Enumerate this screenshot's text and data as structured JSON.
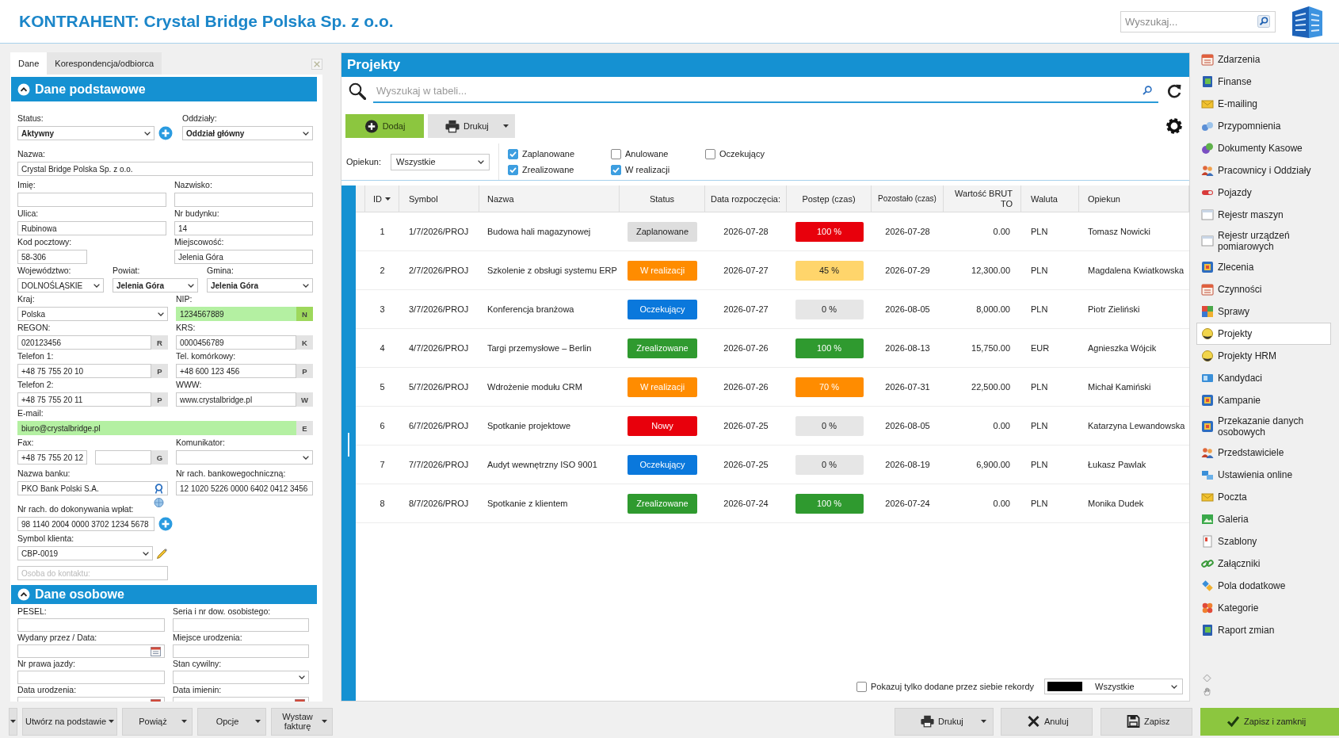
{
  "header": {
    "title": "KONTRAHENT: Crystal Bridge Polska Sp. z o.o.",
    "search": {
      "placeholder": "Wyszukaj..."
    }
  },
  "left_panel": {
    "tabs": [
      {
        "label": "Dane",
        "selected": true
      },
      {
        "label": "Korespondencja/odbiorca",
        "selected": false
      }
    ],
    "sections": [
      {
        "title": "Dane podstawowe",
        "expanded": true,
        "rows": [
          [
            {
              "label": "Status:",
              "value": "Aktywny",
              "kind": "select-add",
              "bold": true,
              "highlighted": false
            },
            {
              "label": "Oddziały:",
              "value": "Oddział główny",
              "kind": "select",
              "bold": true,
              "highlighted": false
            }
          ],
          [
            {
              "label": "Nazwa:",
              "value": "Crystal Bridge Polska Sp. z o.o.",
              "kind": "text",
              "bold": false,
              "highlighted": false
            }
          ],
          [
            {
              "label": "Imię:",
              "kind": "text",
              "bold": false,
              "highlighted": false
            },
            {
              "label": "Nazwisko:",
              "kind": "text",
              "bold": false,
              "highlighted": false
            }
          ],
          [
            {
              "label": "Ulica:",
              "value": "Rubinowa",
              "kind": "text",
              "bold": false,
              "highlighted": false
            },
            {
              "label": "Nr budynku:",
              "value": "14",
              "kind": "text",
              "bold": false,
              "highlighted": false
            }
          ],
          [
            {
              "label": "Kod pocztowy:",
              "value": "58-306",
              "kind": "text",
              "bold": false,
              "highlighted": false
            },
            {
              "label": "Miejscowość:",
              "value": "Jelenia Góra",
              "kind": "text",
              "bold": false,
              "highlighted": false
            }
          ],
          [
            {
              "label": "Województwo:",
              "value": "DOLNOŚLĄSKIE",
              "kind": "select",
              "bold": false,
              "highlighted": false
            },
            {
              "label": "Powiat:",
              "value": "Jelenia Góra",
              "kind": "select",
              "bold": true,
              "highlighted": false
            },
            {
              "label": "Gmina:",
              "value": "Jelenia Góra",
              "kind": "select",
              "bold": true,
              "highlighted": false
            }
          ],
          [
            {
              "label": "Kraj:",
              "value": "Polska",
              "kind": "select",
              "bold": false,
              "highlighted": false
            },
            {
              "label": "NIP:",
              "value": "1234567889",
              "kind": "suffix",
              "suffix": "N",
              "suffix_highlighted": true,
              "bold": false,
              "highlighted": true
            }
          ],
          [
            {
              "label": "REGON:",
              "value": "020123456",
              "kind": "suffix",
              "suffix": "R",
              "suffix_highlighted": false,
              "bold": false,
              "highlighted": false
            },
            {
              "label": "KRS:",
              "value": "0000456789",
              "kind": "suffix",
              "suffix": "K",
              "suffix_highlighted": false,
              "bold": false,
              "highlighted": false
            }
          ],
          [
            {
              "label": "Telefon 1:",
              "value": "+48 75 755 20 10",
              "kind": "suffix",
              "suffix": "P",
              "suffix_highlighted": false,
              "bold": false,
              "highlighted": false
            },
            {
              "label": "Tel. komórkowy:",
              "value": "+48 600 123 456",
              "kind": "suffix",
              "suffix": "P",
              "suffix_highlighted": false,
              "bold": false,
              "highlighted": false
            }
          ],
          [
            {
              "label": "Telefon 2:",
              "value": "+48 75 755 20 11",
              "kind": "suffix",
              "suffix": "P",
              "suffix_highlighted": false,
              "bold": false,
              "highlighted": false
            },
            {
              "label": "WWW:",
              "value": "www.crystalbridge.pl",
              "kind": "suffix",
              "suffix": "W",
              "suffix_highlighted": false,
              "bold": false,
              "highlighted": false
            }
          ],
          [
            {
              "label": "E-mail:",
              "value": "biuro@crystalbridge.pl",
              "kind": "suffix",
              "suffix": "E",
              "suffix_highlighted": false,
              "bold": false,
              "highlighted": true
            }
          ],
          [
            {
              "label": "Fax:",
              "value": "+48 75 755 20 12",
              "kind": "text",
              "bold": false,
              "highlighted": false
            },
            {
              "kind": "suffix",
              "suffix": "G",
              "suffix_highlighted": false,
              "bold": false,
              "highlighted": false
            },
            {
              "label": "Komunikator:",
              "kind": "select",
              "bold": false,
              "highlighted": false
            }
          ],
          [
            {
              "label": "Nazwa banku:",
              "value": "PKO Bank Polski S.A.",
              "kind": "bank",
              "bold": false,
              "highlighted": false
            },
            {
              "label": "Nr rach. bankowegochniczną:",
              "value": "12 1020 5226 0000 6402 0412 3456",
              "kind": "text",
              "bold": false,
              "highlighted": false
            }
          ],
          [
            {
              "label": "Nr rach. do dokonywania wpłat:",
              "value": "98 1140 2004 0000 3702 1234 5678",
              "kind": "text-add",
              "bold": false,
              "highlighted": false
            }
          ],
          [
            {
              "label": "Symbol klienta:",
              "value": "CBP-0019",
              "kind": "select-edit",
              "bold": false,
              "highlighted": false
            }
          ],
          [
            {
              "placeholder": "Osoba do kontaktu:",
              "kind": "text",
              "bold": false,
              "highlighted": false
            }
          ]
        ]
      },
      {
        "title": "Dane osobowe",
        "expanded": true,
        "rows": [
          [
            {
              "label": "PESEL:",
              "kind": "text",
              "bold": false,
              "highlighted": false
            },
            {
              "label": "Seria i nr dow. osobistego:",
              "kind": "text",
              "bold": false,
              "highlighted": false
            }
          ],
          [
            {
              "label": "Wydany przez / Data:",
              "kind": "date",
              "bold": false,
              "highlighted": false
            },
            {
              "label": "Miejsce urodzenia:",
              "kind": "text",
              "bold": false,
              "highlighted": false
            }
          ],
          [
            {
              "label": "Nr prawa jazdy:",
              "kind": "text",
              "bold": false,
              "highlighted": false
            },
            {
              "label": "Stan cywilny:",
              "kind": "select",
              "bold": false,
              "highlighted": false
            }
          ],
          [
            {
              "label": "Data urodzenia:",
              "kind": "date",
              "bold": false,
              "highlighted": false
            },
            {
              "label": "Data imienin:",
              "kind": "date",
              "bold": false,
              "highlighted": false
            }
          ]
        ]
      }
    ]
  },
  "projects_panel": {
    "title": "Projekty",
    "search": {
      "placeholder": "Wyszukaj w tabeli..."
    },
    "buttons": [
      {
        "label": "Dodaj",
        "kind": "add"
      },
      {
        "label": "Drukuj",
        "kind": "print"
      }
    ],
    "owner_filter": {
      "label": "Opiekun:",
      "value": "Wszystkie"
    },
    "status_filters": [
      {
        "label": "Zaplanowane",
        "checked": true
      },
      {
        "label": "Anulowane",
        "checked": false
      },
      {
        "label": "Oczekujący",
        "checked": false
      },
      {
        "label": "Zrealizowane",
        "checked": true
      },
      {
        "label": "W realizacji",
        "checked": true
      }
    ],
    "table": {
      "columns": [
        {
          "label": "ID",
          "sorted": true
        },
        {
          "label": "Symbol",
          "sorted": false
        },
        {
          "label": "Nazwa",
          "sorted": false
        },
        {
          "label": "Status",
          "sorted": false
        },
        {
          "label": "Data rozpoczęcia:",
          "sorted": false
        },
        {
          "label": "Postęp (czas)",
          "sorted": false
        },
        {
          "label": "Pozostało (czas)",
          "sorted": false
        },
        {
          "label": "Wartość BRUTTO",
          "sorted": false
        },
        {
          "label": "Waluta",
          "sorted": false
        },
        {
          "label": "Opiekun",
          "sorted": false
        }
      ],
      "rows": [
        {
          "id": "1",
          "symbol": "1/7/2026/PROJ",
          "name": "Budowa hali magazynowej",
          "status": {
            "label": "Zaplanowane",
            "color": "#dedede"
          },
          "start_date": "2026-07-28",
          "progress": {
            "label": "100 %",
            "color": "#e8000c"
          },
          "remaining": "2026-07-28",
          "value": "0.00",
          "currency": "PLN",
          "owner": "Tomasz Nowicki"
        },
        {
          "id": "2",
          "symbol": "2/7/2026/PROJ",
          "name": "Szkolenie z obsługi systemu ERP",
          "status": {
            "label": "W realizacji",
            "color": "#ff8c00"
          },
          "start_date": "2026-07-27",
          "progress": {
            "label": "45 %",
            "color": "#ffd56b"
          },
          "remaining": "2026-07-29",
          "value": "12,300.00",
          "currency": "PLN",
          "owner": "Magdalena Kwiatkowska"
        },
        {
          "id": "3",
          "symbol": "3/7/2026/PROJ",
          "name": "Konferencja branżowa",
          "status": {
            "label": "Oczekujący",
            "color": "#0a78dc"
          },
          "start_date": "2026-07-27",
          "progress": {
            "label": "0 %",
            "color": "#e6e6e6"
          },
          "remaining": "2026-08-05",
          "value": "8,000.00",
          "currency": "PLN",
          "owner": "Piotr Zieliński"
        },
        {
          "id": "4",
          "symbol": "4/7/2026/PROJ",
          "name": "Targi przemysłowe – Berlin",
          "status": {
            "label": "Zrealizowane",
            "color": "#2f9a2f"
          },
          "start_date": "2026-07-26",
          "progress": {
            "label": "100 %",
            "color": "#2f9a2f"
          },
          "remaining": "2026-08-13",
          "value": "15,750.00",
          "currency": "EUR",
          "owner": "Agnieszka Wójcik"
        },
        {
          "id": "5",
          "symbol": "5/7/2026/PROJ",
          "name": "Wdrożenie modułu CRM",
          "status": {
            "label": "W realizacji",
            "color": "#ff8c00"
          },
          "start_date": "2026-07-26",
          "progress": {
            "label": "70 %",
            "color": "#ff8c00"
          },
          "remaining": "2026-07-31",
          "value": "22,500.00",
          "currency": "PLN",
          "owner": "Michał Kamiński"
        },
        {
          "id": "6",
          "symbol": "6/7/2026/PROJ",
          "name": "Spotkanie projektowe",
          "status": {
            "label": "Nowy",
            "color": "#e8000c"
          },
          "start_date": "2026-07-25",
          "progress": {
            "label": "0 %",
            "color": "#e6e6e6"
          },
          "remaining": "2026-08-05",
          "value": "0.00",
          "currency": "PLN",
          "owner": "Katarzyna Lewandowska"
        },
        {
          "id": "7",
          "symbol": "7/7/2026/PROJ",
          "name": "Audyt wewnętrzny ISO 9001",
          "status": {
            "label": "Oczekujący",
            "color": "#0a78dc"
          },
          "start_date": "2026-07-25",
          "progress": {
            "label": "0 %",
            "color": "#e6e6e6"
          },
          "remaining": "2026-08-19",
          "value": "6,900.00",
          "currency": "PLN",
          "owner": "Łukasz Pawlak"
        },
        {
          "id": "8",
          "symbol": "8/7/2026/PROJ",
          "name": "Spotkanie z klientem",
          "status": {
            "label": "Zrealizowane",
            "color": "#2f9a2f"
          },
          "start_date": "2026-07-24",
          "progress": {
            "label": "100 %",
            "color": "#2f9a2f"
          },
          "remaining": "2026-07-24",
          "value": "0.00",
          "currency": "PLN",
          "owner": "Monika Dudek"
        }
      ]
    },
    "footer": {
      "own_records": {
        "label": "Pokazuj tylko dodane przez siebie rekordy",
        "checked": false
      },
      "color_filter": {
        "color": "#000000",
        "value": "Wszystkie"
      }
    }
  },
  "sidebar": {
    "items": [
      {
        "label": "Zdarzenia",
        "selected": false
      },
      {
        "label": "Finanse",
        "selected": false
      },
      {
        "label": "E-mailing",
        "selected": false
      },
      {
        "label": "Przypomnienia",
        "selected": false
      },
      {
        "label": "Dokumenty Kasowe",
        "selected": false
      },
      {
        "label": "Pracownicy i Oddziały",
        "selected": false
      },
      {
        "label": "Pojazdy",
        "selected": false
      },
      {
        "label": "Rejestr maszyn",
        "selected": false
      },
      {
        "label": "Rejestr urządzeń pomiarowych",
        "selected": false
      },
      {
        "label": "Zlecenia",
        "selected": false
      },
      {
        "label": "Czynności",
        "selected": false
      },
      {
        "label": "Sprawy",
        "selected": false
      },
      {
        "label": "Projekty",
        "selected": true
      },
      {
        "label": "Projekty HRM",
        "selected": false
      },
      {
        "label": "Kandydaci",
        "selected": false
      },
      {
        "label": "Kampanie",
        "selected": false
      },
      {
        "label": "Przekazanie danych osobowych",
        "selected": false
      },
      {
        "label": "Przedstawiciele",
        "selected": false
      },
      {
        "label": "Ustawienia online",
        "selected": false
      },
      {
        "label": "Poczta",
        "selected": false
      },
      {
        "label": "Galeria",
        "selected": false
      },
      {
        "label": "Szablony",
        "selected": false
      },
      {
        "label": "Załączniki",
        "selected": false
      },
      {
        "label": "Pola dodatkowe",
        "selected": false
      },
      {
        "label": "Kategorie",
        "selected": false
      },
      {
        "label": "Raport zmian",
        "selected": false
      }
    ]
  },
  "bottom_bar": {
    "left_buttons": [
      {
        "label": "Utwórz na podstawie",
        "kind": "inline-menu"
      },
      {
        "label": "Powiąż",
        "kind": "split-menu"
      },
      {
        "label": "Opcje",
        "kind": "split-menu"
      },
      {
        "label": "Wystaw fakturę",
        "kind": "split-menu"
      }
    ],
    "right_buttons": [
      {
        "label": "Drukuj",
        "kind": "print"
      },
      {
        "label": "Anuluj",
        "kind": "cancel"
      },
      {
        "label": "Zapisz",
        "kind": "save"
      },
      {
        "label": "Zapisz i zamknij",
        "kind": "save-close"
      }
    ]
  }
}
